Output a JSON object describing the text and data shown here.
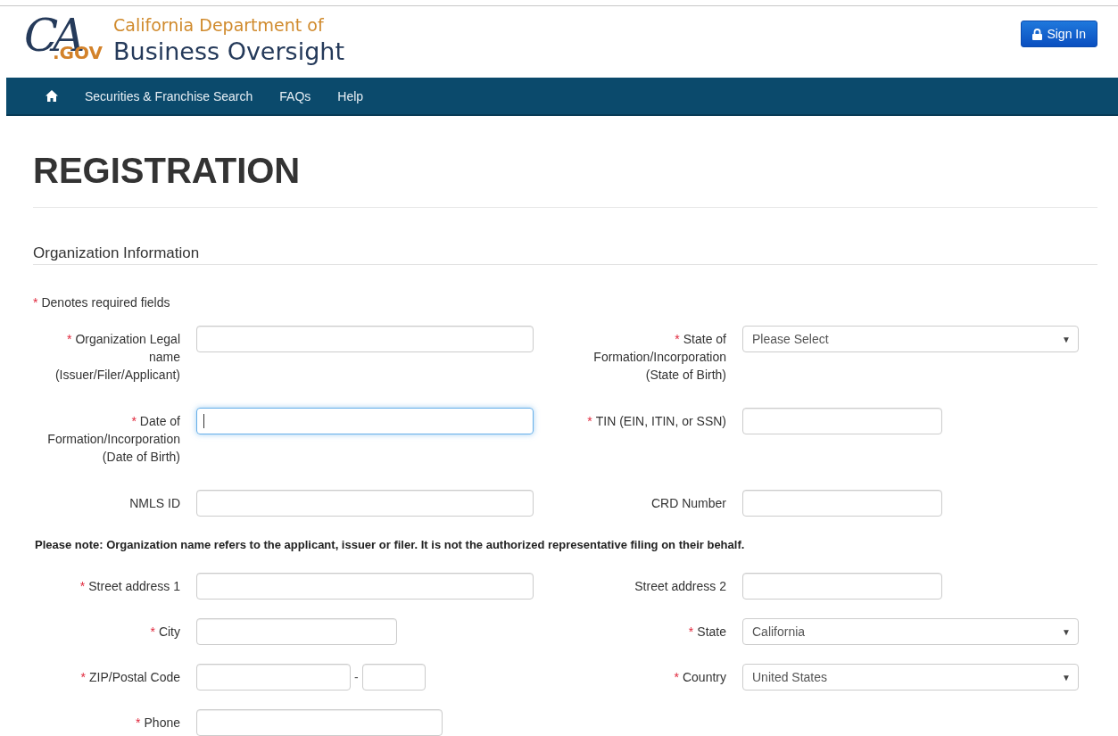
{
  "header": {
    "logo": {
      "mark": "CA",
      "suffix": ".GOV"
    },
    "title_top": "California Department of",
    "title_bottom": "Business Oversight",
    "sign_in": "Sign In"
  },
  "nav": {
    "items": [
      "Securities & Franchise Search",
      "FAQs",
      "Help"
    ]
  },
  "page_title": "REGISTRATION",
  "section_title": "Organization Information",
  "required_note": {
    "mark": "*",
    "text": "Denotes required fields"
  },
  "rows_top": [
    {
      "left": {
        "mark": "*",
        "label": "Organization Legal\nname\n(Issuer/Filer/Applicant)",
        "kind": "text",
        "focused": false
      },
      "right": {
        "mark": "*",
        "label": "State of\nFormation/Incorporation\n(State of Birth)",
        "kind": "select",
        "value": "Please Select",
        "arrow": "▼"
      }
    },
    {
      "left": {
        "mark": "*",
        "label": "Date of\nFormation/Incorporation\n(Date of Birth)",
        "kind": "text",
        "focused": true
      },
      "right": {
        "mark": "*",
        "label": "TIN (EIN, ITIN, or SSN)",
        "kind": "text",
        "focused": false
      }
    },
    {
      "left": {
        "label": "NMLS ID",
        "kind": "text",
        "focused": false
      },
      "right": {
        "label": "CRD Number",
        "kind": "text",
        "focused": false
      }
    }
  ],
  "note": "Please note: Organization name refers to the applicant, issuer or filer. It is not the authorized representative filing on their behalf.",
  "rows_bottom": [
    {
      "left": {
        "mark": "*",
        "label": "Street address 1",
        "kind": "text",
        "focused": false
      },
      "right": {
        "label": "Street address 2",
        "kind": "text",
        "focused": false
      }
    },
    {
      "left": {
        "mark": "*",
        "label": "City",
        "kind": "text",
        "focused": false
      },
      "right": {
        "mark": "*",
        "label": "State",
        "kind": "select",
        "value": "California",
        "arrow": "▼"
      }
    },
    {
      "left": {
        "mark": "*",
        "label": "ZIP/Postal Code",
        "kind": "zip",
        "separator": "-"
      },
      "right": {
        "mark": "*",
        "label": "Country",
        "kind": "select",
        "value": "United States",
        "arrow": "▼"
      }
    },
    {
      "left": {
        "mark": "*",
        "label": "Phone",
        "kind": "text",
        "focused": false
      }
    }
  ]
}
